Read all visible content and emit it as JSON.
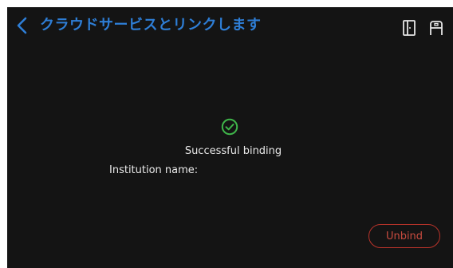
{
  "header": {
    "title": "クラウドサービスとリンクします",
    "back_icon": "chevron-left-icon",
    "right_icons": [
      "door-icon",
      "badge-icon"
    ]
  },
  "status": {
    "icon": "check-circle-icon",
    "message": "Successful binding"
  },
  "institution": {
    "label": "Institution name:"
  },
  "actions": {
    "unbind_label": "Unbind"
  },
  "colors": {
    "background": "#141414",
    "accent": "#2e7ed6",
    "success": "#3fb54a",
    "danger": "#b8332a",
    "text": "#e8e8e8"
  }
}
